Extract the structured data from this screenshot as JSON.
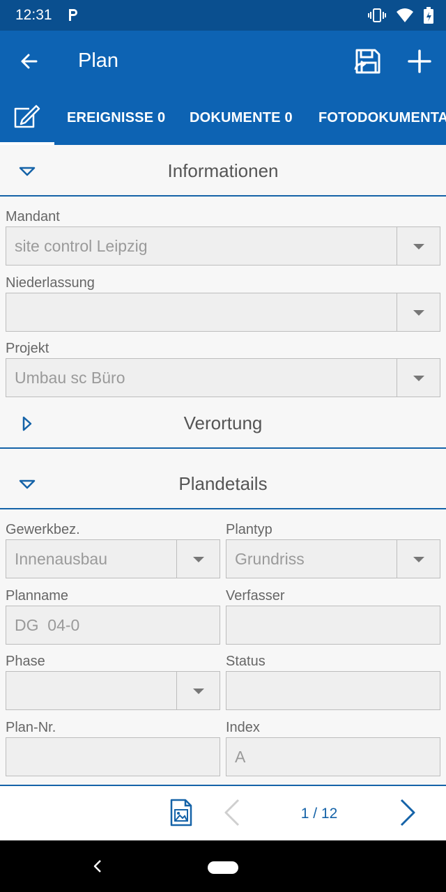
{
  "status_bar": {
    "time": "12:31"
  },
  "app_bar": {
    "title": "Plan"
  },
  "tabs": [
    {
      "label": "EREIGNISSE 0"
    },
    {
      "label": "DOKUMENTE 0"
    },
    {
      "label": "FOTODOKUMENTATION"
    }
  ],
  "sections": {
    "informationen": "Informationen",
    "verortung": "Verortung",
    "plandetails": "Plandetails"
  },
  "informationen": {
    "mandant": {
      "label": "Mandant",
      "value": "site control Leipzig"
    },
    "niederlassung": {
      "label": "Niederlassung",
      "value": ""
    },
    "projekt": {
      "label": "Projekt",
      "value": "Umbau sc Büro"
    }
  },
  "plandetails": {
    "gewerkbez": {
      "label": "Gewerkbez.",
      "value": "Innenausbau"
    },
    "plantyp": {
      "label": "Plantyp",
      "value": "Grundriss"
    },
    "planname": {
      "label": "Planname",
      "value": "DG  04-0"
    },
    "verfasser": {
      "label": "Verfasser",
      "value": ""
    },
    "phase": {
      "label": "Phase",
      "value": ""
    },
    "status": {
      "label": "Status",
      "value": ""
    },
    "plan_nr": {
      "label": "Plan-Nr.",
      "value": ""
    },
    "index": {
      "label": "Index",
      "value": "A"
    }
  },
  "pager": {
    "text": "1 / 12"
  },
  "colors": {
    "primary": "#0d63b3",
    "status_bar": "#0a4f8f",
    "accent": "#1563a8"
  }
}
